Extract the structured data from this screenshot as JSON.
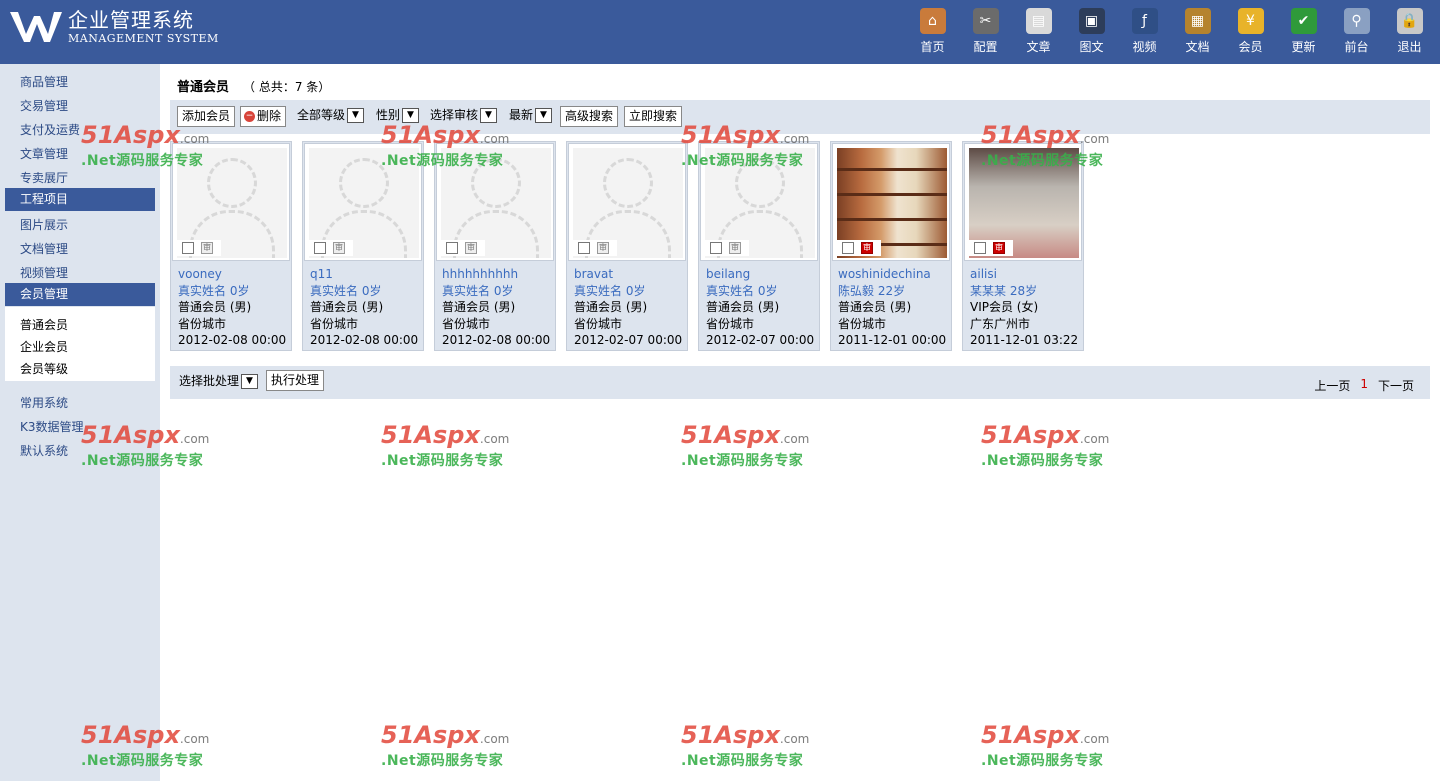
{
  "app": {
    "title_cn": "企业管理系统",
    "title_en": "MANAGEMENT SYSTEM"
  },
  "topnav": [
    {
      "label": "首页",
      "icon": "home-icon",
      "color": "#c97b3b"
    },
    {
      "label": "配置",
      "icon": "tools-icon",
      "color": "#6b6b6b"
    },
    {
      "label": "文章",
      "icon": "article-icon",
      "color": "#d9d9d9"
    },
    {
      "label": "图文",
      "icon": "monitor-icon",
      "color": "#2d3d5a"
    },
    {
      "label": "视频",
      "icon": "flash-icon",
      "color": "#2f4f86"
    },
    {
      "label": "文档",
      "icon": "briefcase-icon",
      "color": "#b5832e"
    },
    {
      "label": "会员",
      "icon": "member-icon",
      "color": "#e8b32a"
    },
    {
      "label": "更新",
      "icon": "update-check-icon",
      "color": "#2f9a3a"
    },
    {
      "label": "前台",
      "icon": "magnifier-icon",
      "color": "#8aa0c2"
    },
    {
      "label": "退出",
      "icon": "lock-icon",
      "color": "#c8c8c8"
    }
  ],
  "sidebar": {
    "items": [
      "商品管理",
      "交易管理",
      "支付及运费",
      "文章管理",
      "专卖展厅",
      "工程项目",
      "图片展示",
      "文档管理",
      "视频管理",
      "会员管理",
      "常用系统",
      "K3数据管理",
      "默认系统"
    ],
    "sub_items": [
      "普通会员",
      "企业会员",
      "会员等级"
    ]
  },
  "page": {
    "title": "普通会员",
    "count": "（ 总共：7 条）"
  },
  "toolbar": {
    "add": "添加会员",
    "delete": "删除",
    "level": "全部等级",
    "gender": "性别",
    "audit": "选择审核",
    "sort": "最新",
    "advanced": "高级搜索",
    "search": "立即搜索"
  },
  "members": [
    {
      "name": "vooney",
      "real": "真实姓名 0岁",
      "type": "普通会员 (男)",
      "city": "省份城市",
      "date": "2012-02-08 00:00",
      "photo": "placeholder"
    },
    {
      "name": "q11",
      "real": "真实姓名 0岁",
      "type": "普通会员 (男)",
      "city": "省份城市",
      "date": "2012-02-08 00:00",
      "photo": "placeholder"
    },
    {
      "name": "hhhhhhhhhh",
      "real": "真实姓名 0岁",
      "type": "普通会员 (男)",
      "city": "省份城市",
      "date": "2012-02-08 00:00",
      "photo": "placeholder"
    },
    {
      "name": "bravat",
      "real": "真实姓名 0岁",
      "type": "普通会员 (男)",
      "city": "省份城市",
      "date": "2012-02-07 00:00",
      "photo": "placeholder"
    },
    {
      "name": "beilang",
      "real": "真实姓名 0岁",
      "type": "普通会员 (男)",
      "city": "省份城市",
      "date": "2012-02-07 00:00",
      "photo": "placeholder"
    },
    {
      "name": "woshinidechina",
      "real": "陈弘毅 22岁",
      "type": "普通会员 (男)",
      "city": "省份城市",
      "date": "2011-12-01 00:00",
      "photo": "furniture"
    },
    {
      "name": "ailisi",
      "real": "某某某 28岁",
      "type": "VIP会员 (女)",
      "city": "广东广州市",
      "date": "2011-12-01 03:22",
      "photo": "mall"
    }
  ],
  "bottom": {
    "batch": "选择批处理",
    "execute": "执行处理",
    "prev": "上一页",
    "current": "1",
    "next": "下一页"
  },
  "watermark": {
    "brand": "51Aspx",
    "domain": ".com",
    "slogan": ".Net源码服务专家"
  }
}
